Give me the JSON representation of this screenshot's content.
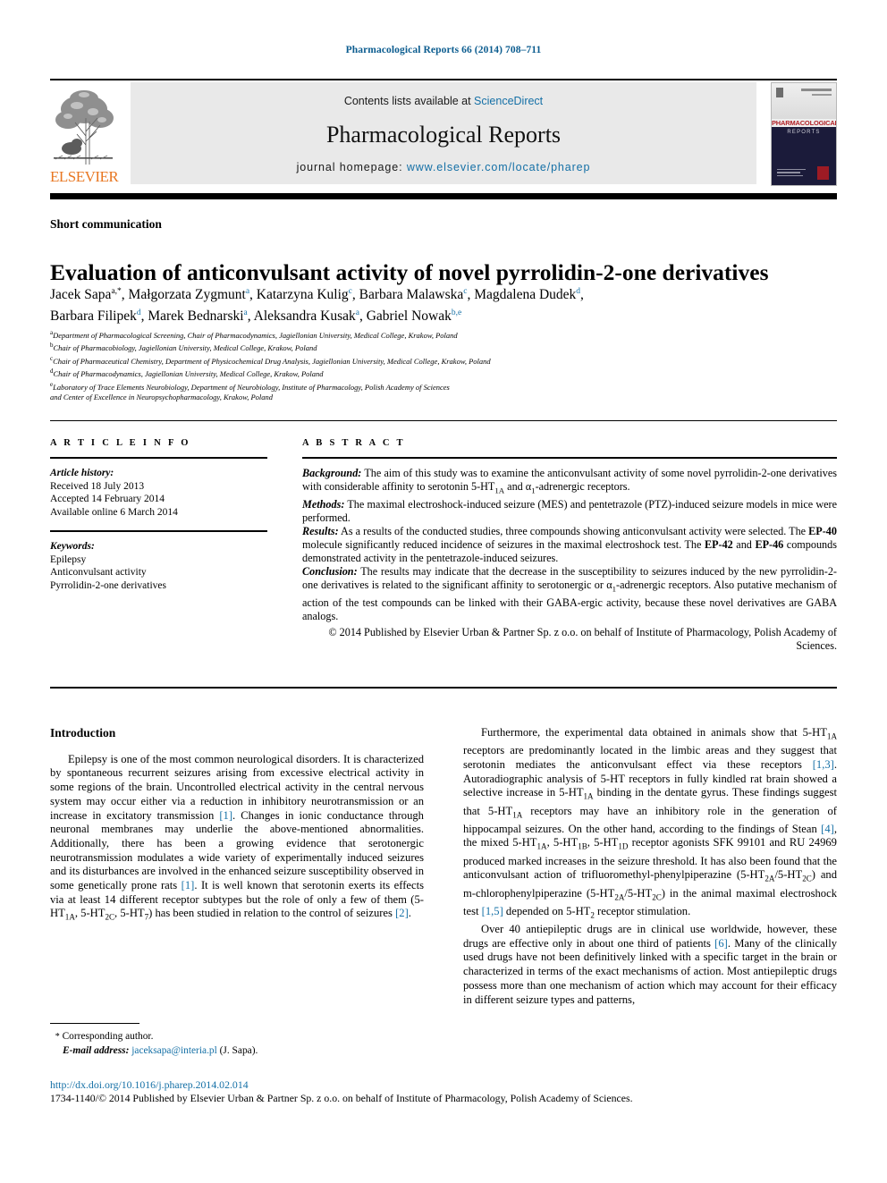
{
  "running_head": "Pharmacological Reports 66 (2014) 708–711",
  "header": {
    "publisher_name": "ELSEVIER",
    "contents_prefix": "Contents lists available at ",
    "sciencedirect": "ScienceDirect",
    "journal_title": "Pharmacological Reports",
    "homepage_prefix": "journal homepage: ",
    "homepage_url": "www.elsevier.com/locate/pharep",
    "cover": {
      "line1": "PHARMACOLOGICAL",
      "line2": "REPORTS"
    }
  },
  "article": {
    "type": "Short communication",
    "title": "Evaluation of anticonvulsant activity of novel pyrrolidin-2-one derivatives",
    "authors_line1_parts": [
      {
        "name": "Jacek Sapa",
        "sup": "a,*"
      },
      {
        "name": "Małgorzata Zygmunt",
        "sup": "a"
      },
      {
        "name": "Katarzyna Kulig",
        "sup": "c"
      },
      {
        "name": "Barbara Malawska",
        "sup": "c"
      },
      {
        "name": "Magdalena Dudek",
        "sup": "d"
      }
    ],
    "authors_line2_parts": [
      {
        "name": "Barbara Filipek",
        "sup": "d"
      },
      {
        "name": "Marek Bednarski",
        "sup": "a"
      },
      {
        "name": "Aleksandra Kusak",
        "sup": "a"
      },
      {
        "name": "Gabriel Nowak",
        "sup": "b,e"
      }
    ],
    "affiliations": [
      {
        "label": "a",
        "text": "Department of Pharmacological Screening, Chair of Pharmacodynamics, Jagiellonian University, Medical College, Krakow, Poland"
      },
      {
        "label": "b",
        "text": "Chair of Pharmacobiology, Jagiellonian University, Medical College, Krakow, Poland"
      },
      {
        "label": "c",
        "text": "Chair of Pharmaceutical Chemistry, Department of Physicochemical Drug Analysis, Jagiellonian University, Medical College, Krakow, Poland"
      },
      {
        "label": "d",
        "text": "Chair of Pharmacodynamics, Jagiellonian University, Medical College, Krakow, Poland"
      },
      {
        "label": "e",
        "text": "Laboratory of Trace Elements Neurobiology, Department of Neurobiology, Institute of Pharmacology, Polish Academy of Sciences"
      },
      {
        "label": "",
        "text": "and Center of Excellence in Neuropsychopharmacology, Krakow, Poland"
      }
    ]
  },
  "article_info": {
    "section_label": "A R T I C L E   I N F O",
    "history_label": "Article history:",
    "history": [
      "Received 18 July 2013",
      "Accepted 14 February 2014",
      "Available online 6 March 2014"
    ],
    "keywords_label": "Keywords:",
    "keywords": [
      "Epilepsy",
      "Anticonvulsant activity",
      "Pyrrolidin-2-one derivatives"
    ]
  },
  "abstract": {
    "section_label": "A B S T R A C T",
    "background_label": "Background:",
    "background_text": " The aim of this study was to examine the anticonvulsant activity of some novel pyrrolidin-2-one derivatives with considerable affinity to serotonin 5-HT1A and α1-adrenergic receptors.",
    "methods_label": "Methods:",
    "methods_text": " The maximal electroshock-induced seizure (MES) and pentetrazole (PTZ)-induced seizure models in mice were performed.",
    "results_label": "Results:",
    "results_text": " As a results of the conducted studies, three compounds showing anticonvulsant activity were selected. The EP-40 molecule significantly reduced incidence of seizures in the maximal electroshock test. The EP-42 and EP-46 compounds demonstrated activity in the pentetrazole-induced seizures.",
    "conclusion_label": "Conclusion:",
    "conclusion_text": " The results may indicate that the decrease in the susceptibility to seizures induced by the new pyrrolidin-2-one derivatives is related to the significant affinity to serotonergic or α1-adrenergic receptors. Also putative mechanism of action of the test compounds can be linked with their GABA-ergic activity, because these novel derivatives are GABA analogs.",
    "copyright": "© 2014 Published by Elsevier Urban & Partner Sp. z o.o. on behalf of Institute of Pharmacology, Polish Academy of Sciences."
  },
  "body": {
    "intro_heading": "Introduction",
    "left_para1": "Epilepsy is one of the most common neurological disorders. It is characterized by spontaneous recurrent seizures arising from excessive electrical activity in some regions of the brain. Uncontrolled electrical activity in the central nervous system may occur either via a reduction in inhibitory neurotransmission or an increase in excitatory transmission [1]. Changes in ionic conductance through neuronal membranes may underlie the above-mentioned abnormalities. Additionally, there has been a growing evidence that serotonergic neurotransmission modulates a wide variety of experimentally induced seizures and its disturbances are involved in the enhanced seizure susceptibility observed in some genetically prone rats [1]. It is well known that serotonin exerts its effects via at least 14 different receptor subtypes but the role of only a few of them (5-HT1A, 5-HT2C, 5-HT7) has been studied in relation to the control of seizures [2].",
    "right_para1": "Furthermore, the experimental data obtained in animals show that 5-HT1A receptors are predominantly located in the limbic areas and they suggest that serotonin mediates the anticonvulsant effect via these receptors [1,3]. Autoradiographic analysis of 5-HT receptors in fully kindled rat brain showed a selective increase in 5-HT1A binding in the dentate gyrus. These findings suggest that 5-HT1A receptors may have an inhibitory role in the generation of hippocampal seizures. On the other hand, according to the findings of Stean [4], the mixed 5-HT1A, 5-HT1B, 5-HT1D receptor agonists SFK 99101 and RU 24969 produced marked increases in the seizure threshold. It has also been found that the anticonvulsant action of trifluoromethyl-phenylpiperazine (5-HT2A/5-HT2C) and m-chlorophenylpiperazine (5-HT2A/5-HT2C) in the animal maximal electroshock test [1,5] depended on 5-HT2 receptor stimulation.",
    "right_para2": "Over 40 antiepileptic drugs are in clinical use worldwide, however, these drugs are effective only in about one third of patients [6]. Many of the clinically used drugs have not been definitively linked with a specific target in the brain or characterized in terms of the exact mechanisms of action. Most antiepileptic drugs possess more than one mechanism of action which may account for their efficacy in different seizure types and patterns,"
  },
  "footer": {
    "corresponding_star": "*",
    "corresponding_label": "Corresponding author.",
    "email_label": "E-mail address:",
    "email": "jaceksapa@interia.pl",
    "email_owner": " (J. Sapa).",
    "doi": "http://dx.doi.org/10.1016/j.pharep.2014.02.014",
    "issn_line": "1734-1140/© 2014 Published by Elsevier Urban & Partner Sp. z o.o. on behalf of Institute of Pharmacology, Polish Academy of Sciences."
  },
  "colors": {
    "link_blue": "#1570a6",
    "elsevier_orange": "#e87722",
    "banner_gray": "#e9e9e9"
  }
}
